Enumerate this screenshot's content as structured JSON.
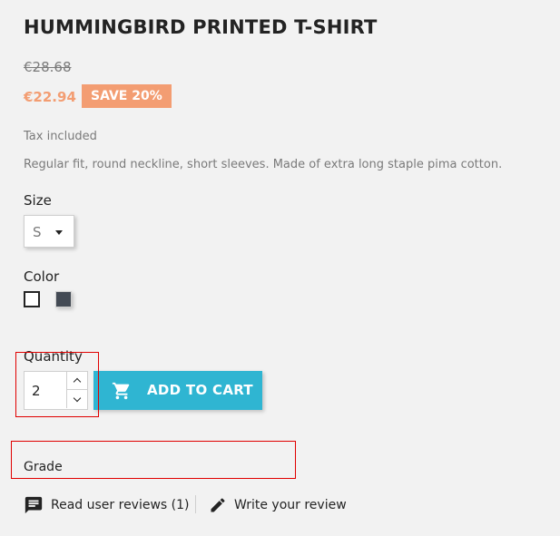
{
  "product": {
    "title": "HUMMINGBIRD PRINTED T-SHIRT",
    "old_price": "€28.68",
    "price": "€22.94",
    "discount_badge": "SAVE 20%",
    "tax_note": "Tax included",
    "description": "Regular fit, round neckline, short sleeves. Made of extra long staple pima cotton."
  },
  "size": {
    "label": "Size",
    "selected": "S"
  },
  "color": {
    "label": "Color",
    "swatches": [
      {
        "name": "white",
        "hex": "#ffffff",
        "selected": true
      },
      {
        "name": "dark-grey",
        "hex": "#434a54",
        "selected": false
      }
    ]
  },
  "quantity": {
    "label": "Quantity",
    "value": "2"
  },
  "cart": {
    "button_label": "ADD TO CART",
    "icon": "shopping-cart-icon",
    "color": "#2fb5d2"
  },
  "grade": {
    "label": "Grade"
  },
  "reviews": {
    "read_label": "Read user reviews (1)",
    "read_icon": "comment-icon",
    "write_label": "Write your review",
    "write_icon": "pencil-icon"
  },
  "colors": {
    "accent_price": "#f39d72",
    "highlight_box": "#e00000"
  }
}
